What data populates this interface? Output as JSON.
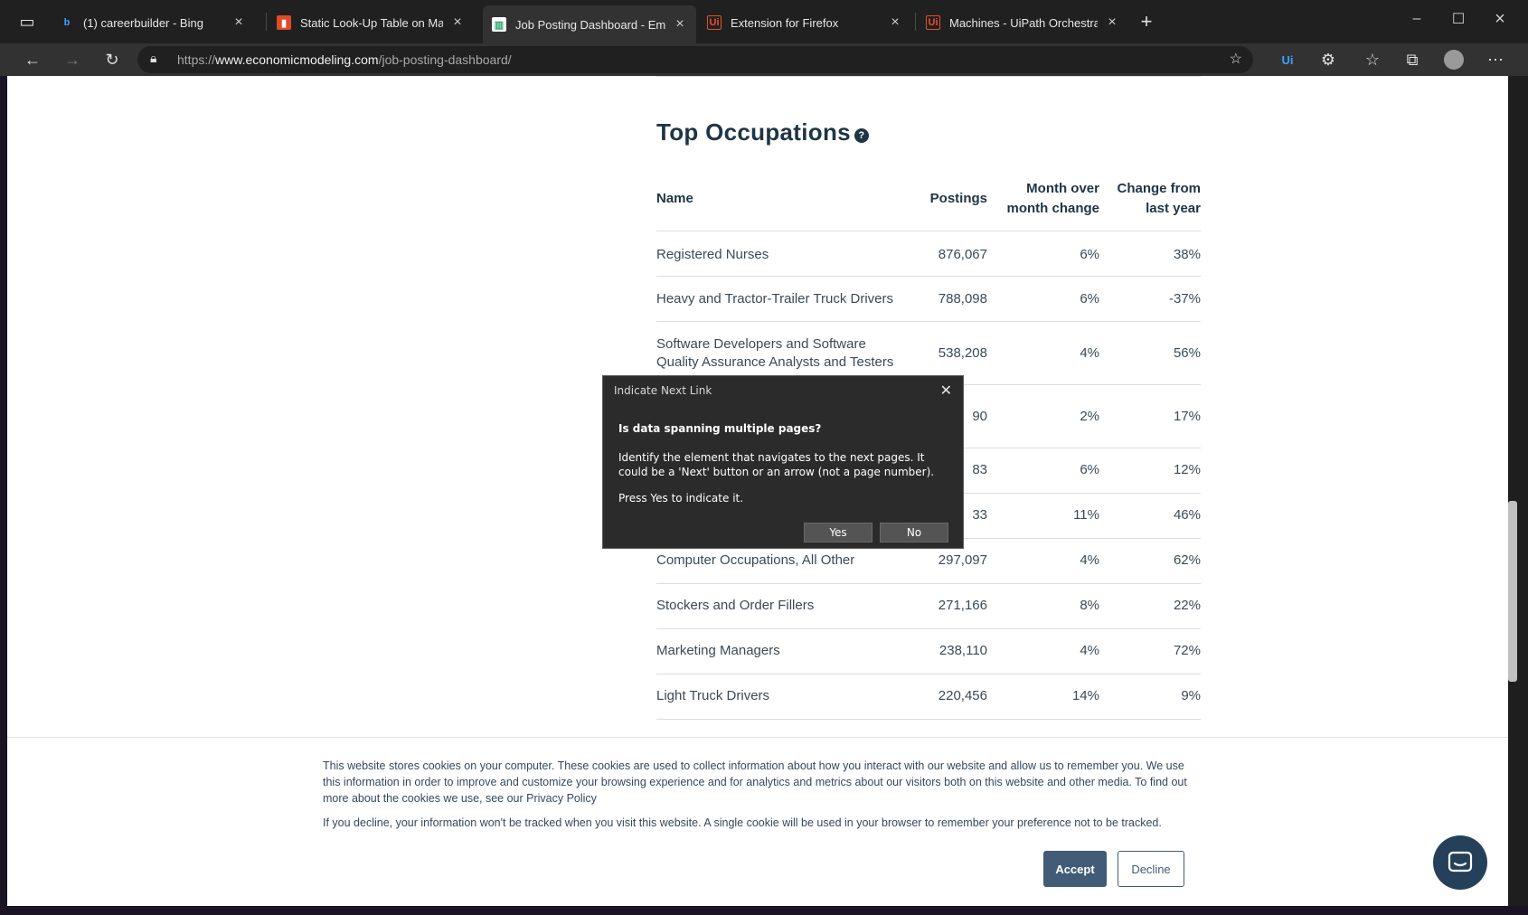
{
  "browser": {
    "tabs": [
      {
        "label": "(1) careerbuilder - Bing",
        "favicon": "bing-icon",
        "active": false
      },
      {
        "label": "Static Look-Up Table on Marielle",
        "favicon": "doc-icon",
        "active": false
      },
      {
        "label": "Job Posting Dashboard - Emsi",
        "favicon": "chart-icon",
        "active": true
      },
      {
        "label": "Extension for Firefox",
        "favicon": "uipath-icon",
        "active": false
      },
      {
        "label": "Machines - UiPath Orchestrator",
        "favicon": "uipath-icon",
        "active": false
      }
    ],
    "url_prefix": "https://",
    "url_host": "www.economicmodeling.com",
    "url_path": "/job-posting-dashboard/"
  },
  "section": {
    "title": "Top Occupations",
    "help": "?"
  },
  "table": {
    "headers": {
      "name": "Name",
      "postings": "Postings",
      "mom_line1": "Month over",
      "mom_line2": "month change",
      "yoy_line1": "Change from",
      "yoy_line2": "last year"
    },
    "rows": [
      {
        "name": "Registered Nurses",
        "postings": "876,067",
        "mom": "6%",
        "yoy": "38%"
      },
      {
        "name": "Heavy and Tractor-Trailer Truck Drivers",
        "postings": "788,098",
        "mom": "6%",
        "yoy": "-37%"
      },
      {
        "name": "Software Developers and Software Quality Assurance Analysts and Testers",
        "postings": "538,208",
        "mom": "4%",
        "yoy": "56%"
      },
      {
        "name": "",
        "postings": "90",
        "mom": "2%",
        "yoy": "17%"
      },
      {
        "name": "",
        "postings": "83",
        "mom": "6%",
        "yoy": "12%"
      },
      {
        "name": "",
        "postings": "33",
        "mom": "11%",
        "yoy": "46%"
      },
      {
        "name": "Computer Occupations, All Other",
        "postings": "297,097",
        "mom": "4%",
        "yoy": "62%"
      },
      {
        "name": "Stockers and Order Fillers",
        "postings": "271,166",
        "mom": "8%",
        "yoy": "22%"
      },
      {
        "name": "Marketing Managers",
        "postings": "238,110",
        "mom": "4%",
        "yoy": "72%"
      },
      {
        "name": "Light Truck Drivers",
        "postings": "220,456",
        "mom": "14%",
        "yoy": "9%"
      }
    ]
  },
  "dialog": {
    "title": "Indicate Next Link",
    "question": "Is data spanning multiple pages?",
    "body": "Identify the element that navigates to the next pages. It could be a 'Next' button or an arrow (not a page number).",
    "press": "Press Yes to indicate it.",
    "yes": "Yes",
    "no": "No"
  },
  "cookie": {
    "text1": "This website stores cookies on your computer. These cookies are used to collect information about how you interact with our website and allow us to remember you. We use this information in order to improve and customize your browsing experience and for analytics and metrics about our visitors both on this website and other media. To find out more about the cookies we use, see our Privacy Policy",
    "text2": "If you decline, your information won't be tracked when you visit this website. A single cookie will be used in your browser to remember your preference not to be tracked.",
    "accept": "Accept",
    "decline": "Decline"
  },
  "colors": {
    "heading": "#1f3545",
    "accept_bg": "#425b76",
    "dialog_bg": "#2b2b2b"
  }
}
